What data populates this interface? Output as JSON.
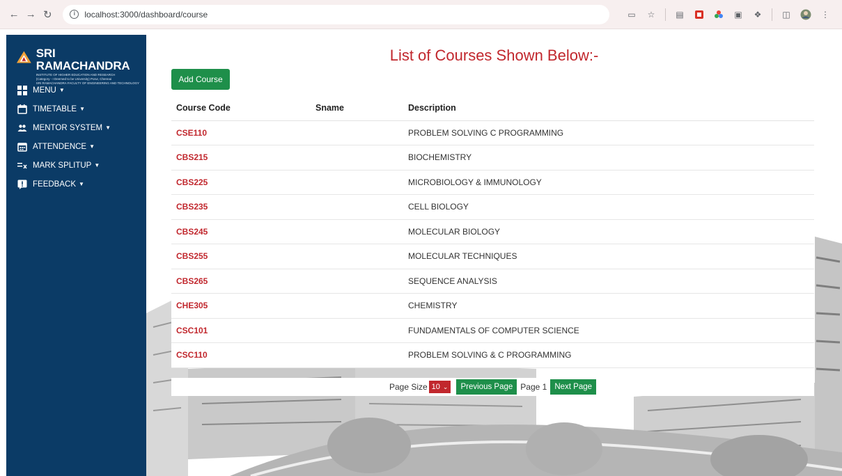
{
  "browser": {
    "url": "localhost:3000/dashboard/course"
  },
  "sidebar": {
    "brand_name": "SRI RAMACHANDRA",
    "brand_line1": "INSTITUTE OF HIGHER EDUCATION AND RESEARCH",
    "brand_line2": "(Category - I Deemed to be University) Porur, Chennai",
    "brand_line3": "SRI RAMACHANDRA FACULTY OF ENGINEERING AND TECHNOLOGY",
    "items": [
      {
        "label": "MENU",
        "icon": "grid-icon"
      },
      {
        "label": "TIMETABLE",
        "icon": "calendar-icon"
      },
      {
        "label": "MENTOR SYSTEM",
        "icon": "users-icon"
      },
      {
        "label": "ATTENDENCE",
        "icon": "calendar-grid-icon"
      },
      {
        "label": "MARK SPLITUP",
        "icon": "list-x-icon"
      },
      {
        "label": "FEEDBACK",
        "icon": "alert-message-icon"
      }
    ]
  },
  "main": {
    "title": "List of Courses Shown Below:-",
    "add_button": "Add Course",
    "columns": [
      "Course Code",
      "Sname",
      "Description"
    ],
    "rows": [
      {
        "code": "CSE110",
        "sname": "",
        "description": "PROBLEM SOLVING C PROGRAMMING"
      },
      {
        "code": "CBS215",
        "sname": "",
        "description": "BIOCHEMISTRY"
      },
      {
        "code": "CBS225",
        "sname": "",
        "description": "MICROBIOLOGY & IMMUNOLOGY"
      },
      {
        "code": "CBS235",
        "sname": "",
        "description": "CELL BIOLOGY"
      },
      {
        "code": "CBS245",
        "sname": "",
        "description": "MOLECULAR BIOLOGY"
      },
      {
        "code": "CBS255",
        "sname": "",
        "description": "MOLECULAR TECHNIQUES"
      },
      {
        "code": "CBS265",
        "sname": "",
        "description": "SEQUENCE ANALYSIS"
      },
      {
        "code": "CHE305",
        "sname": "",
        "description": "CHEMISTRY"
      },
      {
        "code": "CSC101",
        "sname": "",
        "description": "FUNDAMENTALS OF COMPUTER SCIENCE"
      },
      {
        "code": "CSC110",
        "sname": "",
        "description": "PROBLEM SOLVING & C PROGRAMMING"
      }
    ],
    "pager": {
      "page_size_label": "Page Size",
      "page_size_value": "10",
      "prev_label": "Previous Page",
      "page_label": "Page 1",
      "next_label": "Next Page"
    }
  },
  "colors": {
    "sidebar_bg": "#0b3b66",
    "accent_red": "#c1272d",
    "accent_green": "#1e8f4a"
  }
}
